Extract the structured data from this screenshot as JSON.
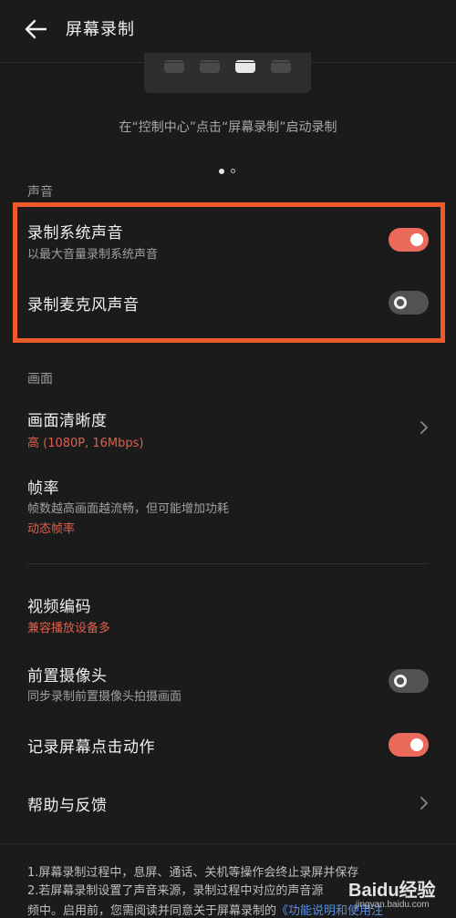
{
  "header": {
    "title": "屏幕录制"
  },
  "intro": {
    "caption": "在“控制中心”点击“屏幕录制”启动录制"
  },
  "sound": {
    "label": "声音",
    "system_title": "录制系统声音",
    "system_sub": "以最大音量录制系统声音",
    "system_on": true,
    "mic_title": "录制麦克风声音",
    "mic_on": false
  },
  "picture": {
    "label": "画面",
    "clarity_title": "画面清晰度",
    "clarity_value": "高 (1080P, 16Mbps)",
    "framerate_title": "帧率",
    "framerate_sub": "帧数越高画面越流畅，但可能增加功耗",
    "framerate_value": "动态帧率"
  },
  "other": {
    "codec_title": "视频编码",
    "codec_value": "兼容播放设备多",
    "camera_title": "前置摄像头",
    "camera_sub": "同步录制前置摄像头拍摄画面",
    "camera_on": false,
    "taps_title": "记录屏幕点击动作",
    "taps_on": true,
    "help_title": "帮助与反馈"
  },
  "notes": {
    "line1": "1.屏幕录制过程中，息屏、通话、关机等操作会终止录屏并保存",
    "line2": "2.若屏幕录制设置了声音来源，录制过程中对应的声音源",
    "line3_prefix": "频中。启用前，您需阅读并同意关于屏幕录制的",
    "line3_link": "《功能说明和使用注"
  },
  "watermark": {
    "brand": "Baidu经验",
    "url": "jingyan.baidu.com"
  },
  "colors": {
    "accent": "#ec6a5c",
    "highlight": "#ef5a2a",
    "link": "#5a8fe0",
    "background": "#1b1b1b"
  },
  "icons": {
    "back": "arrow-left-icon",
    "chevron": "chevron-right-icon"
  }
}
